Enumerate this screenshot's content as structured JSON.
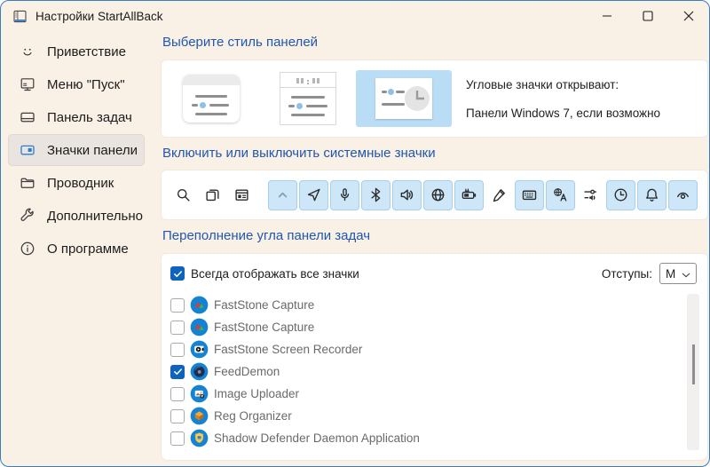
{
  "window": {
    "title": "Настройки StartAllBack",
    "controls": [
      "minimize",
      "maximize",
      "close"
    ]
  },
  "sidebar": {
    "items": [
      {
        "id": "welcome",
        "label": "Приветствие",
        "icon": "smiley-icon",
        "selected": false
      },
      {
        "id": "start-menu",
        "label": "Меню \"Пуск\"",
        "icon": "start-menu-icon",
        "selected": false
      },
      {
        "id": "taskbar",
        "label": "Панель задач",
        "icon": "taskbar-icon",
        "selected": false
      },
      {
        "id": "tray-icons",
        "label": "Значки панели",
        "icon": "tray-icons-icon",
        "selected": true
      },
      {
        "id": "explorer",
        "label": "Проводник",
        "icon": "folder-icon",
        "selected": false
      },
      {
        "id": "advanced",
        "label": "Дополнительно",
        "icon": "wrench-icon",
        "selected": false
      },
      {
        "id": "about",
        "label": "О программе",
        "icon": "info-icon",
        "selected": false
      }
    ]
  },
  "style_section": {
    "heading": "Выберите стиль панелей",
    "selected_index": 2,
    "corner_label": "Угловые значки открывают:",
    "corner_value": "Панели Windows 7, если возможно"
  },
  "system_icons_section": {
    "heading": "Включить или выключить системные значки",
    "icons": [
      {
        "name": "search-icon",
        "enabled": false
      },
      {
        "name": "task-view-icon",
        "enabled": false
      },
      {
        "name": "widgets-icon",
        "enabled": false
      },
      {
        "name": "chevron-up-icon",
        "enabled": true
      },
      {
        "name": "location-icon",
        "enabled": true
      },
      {
        "name": "microphone-icon",
        "enabled": true
      },
      {
        "name": "bluetooth-icon",
        "enabled": true
      },
      {
        "name": "volume-icon",
        "enabled": true
      },
      {
        "name": "network-globe-icon",
        "enabled": true
      },
      {
        "name": "battery-charging-icon",
        "enabled": true
      },
      {
        "name": "pen-icon",
        "enabled": false
      },
      {
        "name": "keyboard-icon",
        "enabled": true
      },
      {
        "name": "language-icon",
        "enabled": true
      },
      {
        "name": "volume-mixer-icon",
        "enabled": false
      },
      {
        "name": "clock-icon",
        "enabled": true
      },
      {
        "name": "notifications-bell-icon",
        "enabled": true
      },
      {
        "name": "show-hidden-eye-icon",
        "enabled": true
      }
    ]
  },
  "overflow_section": {
    "heading": "Переполнение угла панели задач",
    "always_show": {
      "label": "Всегда отображать все значки",
      "checked": true
    },
    "spacing": {
      "label": "Отступы:",
      "value": "M"
    },
    "apps": [
      {
        "name": "FastStone Capture",
        "checked": false,
        "icon": "faststone-capture-icon"
      },
      {
        "name": "FastStone Capture",
        "checked": false,
        "icon": "faststone-capture-icon"
      },
      {
        "name": "FastStone Screen Recorder",
        "checked": false,
        "icon": "faststone-screen-recorder-icon"
      },
      {
        "name": "FeedDemon",
        "checked": true,
        "icon": "feeddemon-icon"
      },
      {
        "name": "Image Uploader",
        "checked": false,
        "icon": "image-uploader-icon"
      },
      {
        "name": "Reg Organizer",
        "checked": false,
        "icon": "reg-organizer-icon"
      },
      {
        "name": "Shadow Defender Daemon Application",
        "checked": false,
        "icon": "shadow-defender-icon"
      }
    ]
  },
  "colors": {
    "accent_heading": "#2157ac",
    "background": "#f9f0e6",
    "window_border": "#3a7dbf",
    "icon_button_bg": "#cde7f8",
    "icon_button_border": "#a6cfec",
    "checkbox_checked": "#0f63bd",
    "selected_style_bg": "#b9ddf5",
    "app_circle_blue": "#1583d3"
  }
}
